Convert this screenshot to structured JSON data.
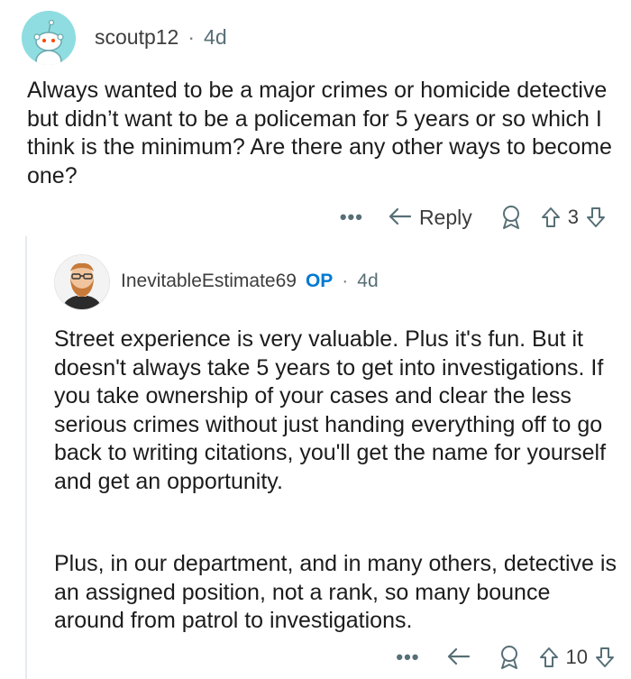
{
  "comment": {
    "username": "scoutp12",
    "separator": "·",
    "age": "4d",
    "body": "Always wanted to be a major crimes or homicide detective but didn’t want to be a policeman for 5 years or so which I think is the minimum? Are there any other ways to become one?",
    "actions": {
      "more": "•••",
      "reply_label": "Reply",
      "score": "3"
    }
  },
  "reply": {
    "username": "InevitableEstimate69",
    "badge": "OP",
    "separator": "·",
    "age": "4d",
    "paragraphs": [
      "Street experience is very valuable. Plus it's fun. But it doesn't always take 5 years to get into investigations. If you take ownership of your cases and clear the less serious crimes without just handing everything off to go back to writing citations, you'll get the name for yourself and get an opportunity.",
      "Plus, in our department, and in many others, detective is an assigned position, not a rank, so many bounce around from patrol to investigations."
    ],
    "actions": {
      "more": "•••",
      "score": "10"
    }
  },
  "colors": {
    "avatar_bg": "#8fdde0",
    "op_badge": "#0079d3",
    "icon_gray": "#576f76",
    "thread_line": "#e5ebee"
  }
}
